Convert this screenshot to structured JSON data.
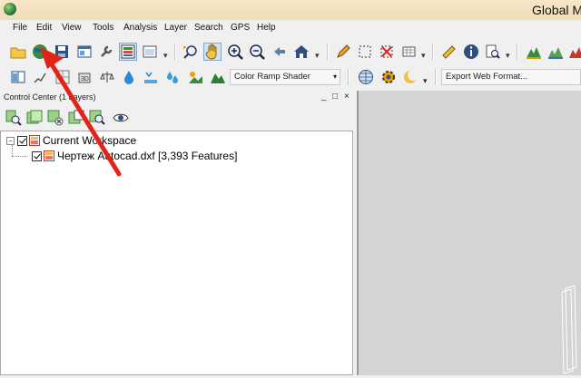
{
  "window": {
    "title": "Global Ma"
  },
  "menu": [
    "File",
    "Edit",
    "View",
    "Tools",
    "Analysis",
    "Layer",
    "Search",
    "GPS",
    "Help"
  ],
  "toolbar": {
    "shader_combo": "Color Ramp Shader",
    "export_combo": "Export Web Format..."
  },
  "control_center": {
    "title": "Control Center (1 Layers)",
    "minimize": "_",
    "maximize": "□",
    "close": "×",
    "tree": [
      {
        "label": "Current Workspace",
        "checked": true,
        "expanded": true
      },
      {
        "label": "Чертеж Autocad.dxf [3,393 Features]",
        "checked": true
      }
    ]
  },
  "annotation": {
    "arrow_color": "#e2231a",
    "points_to": "open-data-button"
  }
}
